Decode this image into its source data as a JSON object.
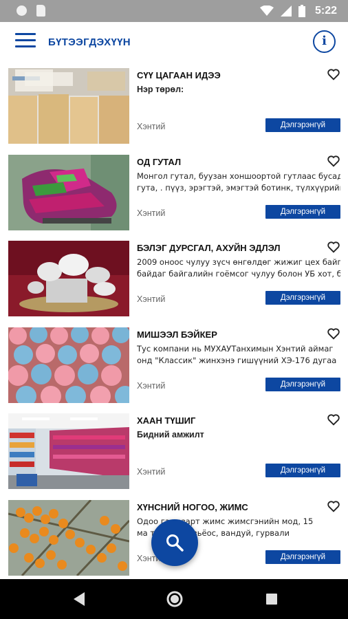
{
  "status_bar": {
    "time": "5:22"
  },
  "header": {
    "title": "БҮТЭЭГДЭХҮҮН",
    "menu_icon": "hamburger-menu-icon",
    "info_icon": "info-icon"
  },
  "accent_color": "#0d47a1",
  "products": [
    {
      "title": "СҮҮ ЦАГААН ИДЭЭ",
      "desc_line1": "Нэр төрөл:",
      "desc_line2": "",
      "desc_bold": true,
      "location": "Хэнтий",
      "more_label": "Дэлгэрэнгүй"
    },
    {
      "title": "ОД ГУТАЛ",
      "desc_line1": "Монгол гутал, буузан хоншоортой гутлаас бусад",
      "desc_line2": "гута, . пүүз, эрэгтэй, эмэгтэй ботинк, түлхүүрийн",
      "desc_bold": false,
      "location": "Хэнтий",
      "more_label": "Дэлгэрэнгүй"
    },
    {
      "title": "БЭЛЭГ ДУРСГАЛ, АХУЙН ЭДЛЭЛ",
      "desc_line1": "2009 оноос чулуу зүсч өнгөлдөг жижиг цех байг",
      "desc_line2": "байдаг байгалийн гоёмсог чулуу болон УБ хот, б",
      "desc_bold": false,
      "location": "Хэнтий",
      "more_label": "Дэлгэрэнгүй"
    },
    {
      "title": "МИШЭЭЛ БЭЙКЕР",
      "desc_line1": "Тус компани нь МУХАУТанхимын Хэнтий аймаг",
      "desc_line2": "онд \"Классик\"  жинхэнэ гишүүний  ХЭ-176 дугаа",
      "desc_bold": false,
      "location": "Хэнтий",
      "more_label": "Дэлгэрэнгүй"
    },
    {
      "title": "ХААН ТҮШИГ",
      "desc_line1": "Бидний амжилт",
      "desc_line2": "",
      "desc_bold": true,
      "location": "Хэнтий",
      "more_label": "Дэлгэрэнгүй"
    },
    {
      "title": "ХҮНСНИЙ НОГОО, ЖИМС",
      "desc_line1": "Одоо     га газарт жимс жимсгэнийн мод, 15",
      "desc_line2": "ма           тэжээл / овьёос, вандуй, гурвали",
      "desc_bold": false,
      "location": "Хэнтий",
      "more_label": "Дэлгэрэнгүй"
    }
  ],
  "fab": {
    "icon": "search-icon"
  },
  "nav_bar": {
    "back_icon": "back-icon",
    "home_icon": "home-icon",
    "recents_icon": "recents-icon"
  }
}
